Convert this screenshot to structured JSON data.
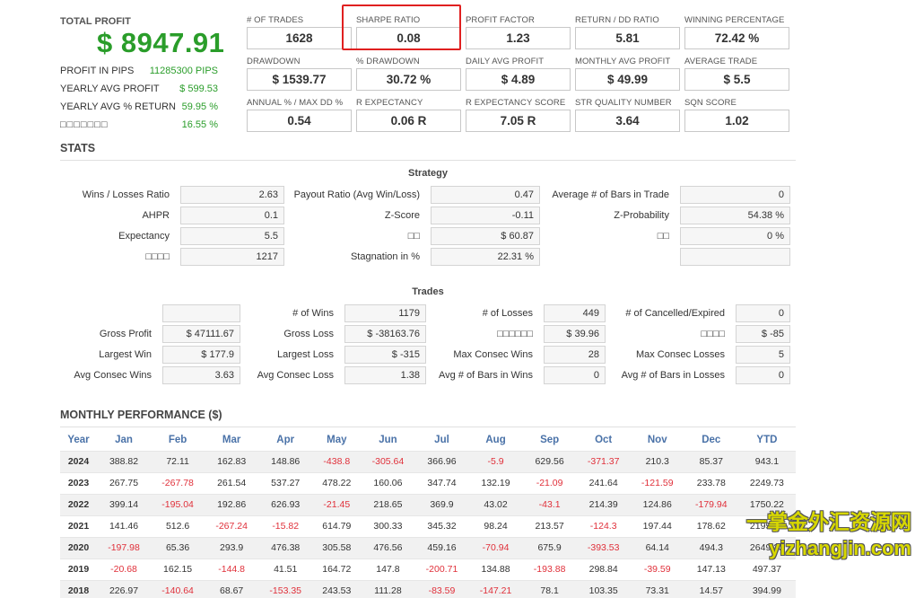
{
  "summary": {
    "total_profit_label": "TOTAL PROFIT",
    "total_profit_value": "$ 8947.91",
    "rows": [
      {
        "label": "PROFIT IN PIPS",
        "value": "11285300 PIPS"
      },
      {
        "label": "YEARLY AVG PROFIT",
        "value": "$ 599.53"
      },
      {
        "label": "YEARLY AVG % RETURN",
        "value": "59.95 %"
      },
      {
        "label": "□□□□□□□",
        "value": "16.55 %"
      }
    ]
  },
  "metrics": [
    {
      "label": "# OF TRADES",
      "value": "1628"
    },
    {
      "label": "SHARPE RATIO",
      "value": "0.08"
    },
    {
      "label": "PROFIT FACTOR",
      "value": "1.23"
    },
    {
      "label": "RETURN / DD RATIO",
      "value": "5.81"
    },
    {
      "label": "WINNING PERCENTAGE",
      "value": "72.42 %"
    },
    {
      "label": "DRAWDOWN",
      "value": "$ 1539.77"
    },
    {
      "label": "% DRAWDOWN",
      "value": "30.72 %"
    },
    {
      "label": "DAILY AVG PROFIT",
      "value": "$ 4.89"
    },
    {
      "label": "MONTHLY AVG PROFIT",
      "value": "$ 49.99"
    },
    {
      "label": "AVERAGE TRADE",
      "value": "$ 5.5"
    },
    {
      "label": "ANNUAL % / MAX DD %",
      "value": "0.54"
    },
    {
      "label": "R EXPECTANCY",
      "value": "0.06 R"
    },
    {
      "label": "R EXPECTANCY SCORE",
      "value": "7.05 R"
    },
    {
      "label": "STR QUALITY NUMBER",
      "value": "3.64"
    },
    {
      "label": "SQN SCORE",
      "value": "1.02"
    }
  ],
  "stats_title": "STATS",
  "strategy": {
    "title": "Strategy",
    "rows": [
      [
        {
          "label": "Wins / Losses Ratio",
          "value": "2.63"
        },
        {
          "label": "Payout Ratio (Avg Win/Loss)",
          "value": "0.47"
        },
        {
          "label": "Average # of Bars in Trade",
          "value": "0"
        }
      ],
      [
        {
          "label": "AHPR",
          "value": "0.1"
        },
        {
          "label": "Z-Score",
          "value": "-0.11"
        },
        {
          "label": "Z-Probability",
          "value": "54.38 %"
        }
      ],
      [
        {
          "label": "Expectancy",
          "value": "5.5"
        },
        {
          "label": "□□",
          "value": "$ 60.87"
        },
        {
          "label": "□□",
          "value": "0 %"
        }
      ],
      [
        {
          "label": "□□□□",
          "value": "1217"
        },
        {
          "label": "Stagnation in %",
          "value": "22.31 %"
        },
        {
          "label": "",
          "value": ""
        }
      ]
    ]
  },
  "trades": {
    "title": "Trades",
    "rows": [
      [
        {
          "label": "",
          "value": ""
        },
        {
          "label": "# of Wins",
          "value": "1179"
        },
        {
          "label": "# of Losses",
          "value": "449"
        },
        {
          "label": "# of Cancelled/Expired",
          "value": "0"
        }
      ],
      [
        {
          "label": "Gross Profit",
          "value": "$ 47111.67"
        },
        {
          "label": "Gross Loss",
          "value": "$ -38163.76"
        },
        {
          "label": "□□□□□□",
          "value": "$ 39.96"
        },
        {
          "label": "□□□□",
          "value": "$ -85"
        }
      ],
      [
        {
          "label": "Largest Win",
          "value": "$ 177.9"
        },
        {
          "label": "Largest Loss",
          "value": "$ -315"
        },
        {
          "label": "Max Consec Wins",
          "value": "28"
        },
        {
          "label": "Max Consec Losses",
          "value": "5"
        }
      ],
      [
        {
          "label": "Avg Consec Wins",
          "value": "3.63"
        },
        {
          "label": "Avg Consec Loss",
          "value": "1.38"
        },
        {
          "label": "Avg # of Bars in Wins",
          "value": "0"
        },
        {
          "label": "Avg # of Bars in Losses",
          "value": "0"
        }
      ]
    ]
  },
  "monthly": {
    "title": "MONTHLY PERFORMANCE ($)",
    "headers": [
      "Year",
      "Jan",
      "Feb",
      "Mar",
      "Apr",
      "May",
      "Jun",
      "Jul",
      "Aug",
      "Sep",
      "Oct",
      "Nov",
      "Dec",
      "YTD"
    ],
    "rows": [
      [
        "2024",
        "388.82",
        "72.11",
        "162.83",
        "148.86",
        "-438.8",
        "-305.64",
        "366.96",
        "-5.9",
        "629.56",
        "-371.37",
        "210.3",
        "85.37",
        "943.1"
      ],
      [
        "2023",
        "267.75",
        "-267.78",
        "261.54",
        "537.27",
        "478.22",
        "160.06",
        "347.74",
        "132.19",
        "-21.09",
        "241.64",
        "-121.59",
        "233.78",
        "2249.73"
      ],
      [
        "2022",
        "399.14",
        "-195.04",
        "192.86",
        "626.93",
        "-21.45",
        "218.65",
        "369.9",
        "43.02",
        "-43.1",
        "214.39",
        "124.86",
        "-179.94",
        "1750.22"
      ],
      [
        "2021",
        "141.46",
        "512.6",
        "-267.24",
        "-15.82",
        "614.79",
        "300.33",
        "345.32",
        "98.24",
        "213.57",
        "-124.3",
        "197.44",
        "178.62",
        "2195.01"
      ],
      [
        "2020",
        "-197.98",
        "65.36",
        "293.9",
        "476.38",
        "305.58",
        "476.56",
        "459.16",
        "-70.94",
        "675.9",
        "-393.53",
        "64.14",
        "494.3",
        "2649.23"
      ],
      [
        "2019",
        "-20.68",
        "162.15",
        "-144.8",
        "41.51",
        "164.72",
        "147.8",
        "-200.71",
        "134.88",
        "-193.88",
        "298.84",
        "-39.59",
        "147.13",
        "497.37"
      ],
      [
        "2018",
        "226.97",
        "-140.64",
        "68.67",
        "-153.35",
        "243.53",
        "111.28",
        "-83.59",
        "-147.21",
        "78.1",
        "103.35",
        "73.31",
        "14.57",
        "394.99"
      ]
    ]
  },
  "watermark": {
    "line1": "一掌金外汇资源网",
    "line2": "yizhangjin.com"
  },
  "colors": {
    "positive": "#2a9d2a",
    "negative": "#e0303a",
    "header_blue": "#4a72a8",
    "highlight_red": "#e02020"
  }
}
